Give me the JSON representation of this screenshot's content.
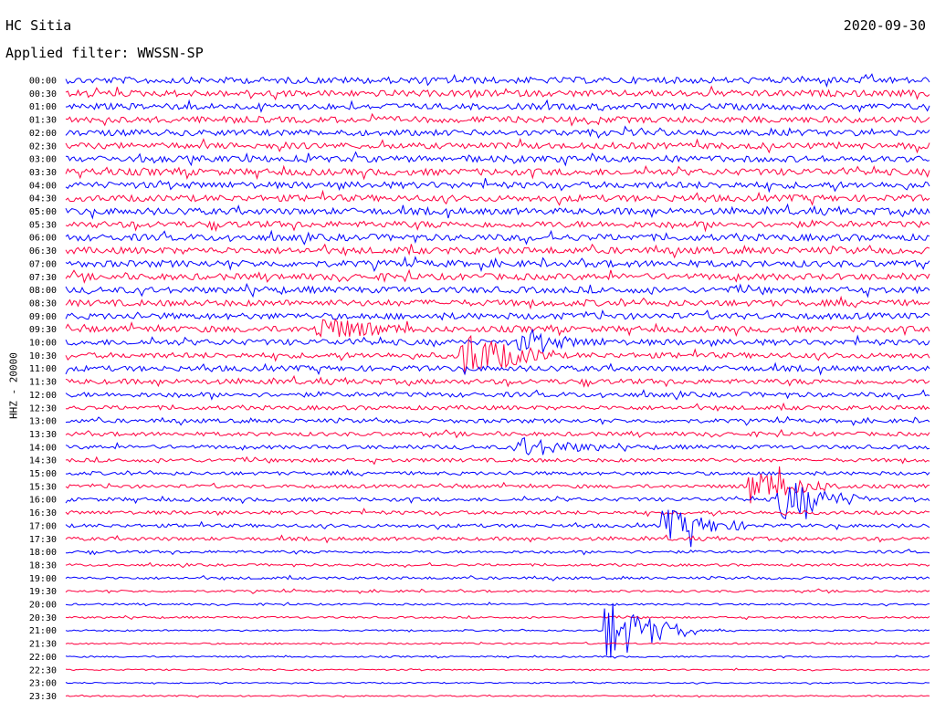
{
  "header": {
    "station": "HC Sitia",
    "date": "2020-09-30",
    "filter": "Applied filter: WWSSN-SP"
  },
  "channel_label": "HHZ - 20000",
  "colors": {
    "even_trace": "#0000ff",
    "odd_trace": "#ff0040",
    "background": "#ffffff"
  },
  "chart_data": {
    "type": "line",
    "title": "HC Sitia",
    "subtitle": "Applied filter: WWSSN-SP",
    "ylabel": "HHZ - 20000",
    "categories": [
      "00:00",
      "00:30",
      "01:00",
      "01:30",
      "02:00",
      "02:30",
      "03:00",
      "03:30",
      "04:00",
      "04:30",
      "05:00",
      "05:30",
      "06:00",
      "06:30",
      "07:00",
      "07:30",
      "08:00",
      "08:30",
      "09:00",
      "09:30",
      "10:00",
      "10:30",
      "11:00",
      "11:30",
      "12:00",
      "12:30",
      "13:00",
      "13:30",
      "14:00",
      "14:30",
      "15:00",
      "15:30",
      "16:00",
      "16:30",
      "17:00",
      "17:30",
      "18:00",
      "18:30",
      "19:00",
      "19:30",
      "20:00",
      "20:30",
      "21:00",
      "21:30",
      "22:00",
      "22:30",
      "23:00",
      "23:30"
    ],
    "line_minutes": 30,
    "noise_amplitude": [
      3.5,
      3.5,
      3.4,
      3.4,
      3.3,
      3.3,
      3.4,
      3.6,
      3.6,
      3.5,
      3.5,
      3.5,
      3.6,
      3.6,
      3.6,
      3.5,
      3.4,
      3.4,
      3.4,
      3.3,
      3.2,
      3.0,
      2.9,
      2.8,
      2.6,
      2.3,
      2.2,
      2.2,
      2.1,
      2.0,
      1.9,
      1.9,
      2.0,
      2.0,
      1.9,
      1.9,
      1.5,
      1.3,
      1.4,
      1.2,
      1.0,
      1.0,
      0.9,
      0.9,
      0.8,
      0.8,
      0.7,
      0.7
    ],
    "events": [
      {
        "trace": "09:30",
        "minute": 9,
        "amplitude": 12
      },
      {
        "trace": "10:00",
        "minute": 16,
        "amplitude": 8
      },
      {
        "trace": "10:30",
        "minute": 14,
        "amplitude": 25
      },
      {
        "trace": "14:00",
        "minute": 16,
        "amplitude": 10
      },
      {
        "trace": "15:30",
        "minute": 24,
        "amplitude": 18
      },
      {
        "trace": "16:00",
        "minute": 25,
        "amplitude": 22
      },
      {
        "trace": "17:00",
        "minute": 21,
        "amplitude": 16
      },
      {
        "trace": "21:00",
        "minute": 19,
        "amplitude": 34
      }
    ],
    "grid": false,
    "legend": "none"
  }
}
